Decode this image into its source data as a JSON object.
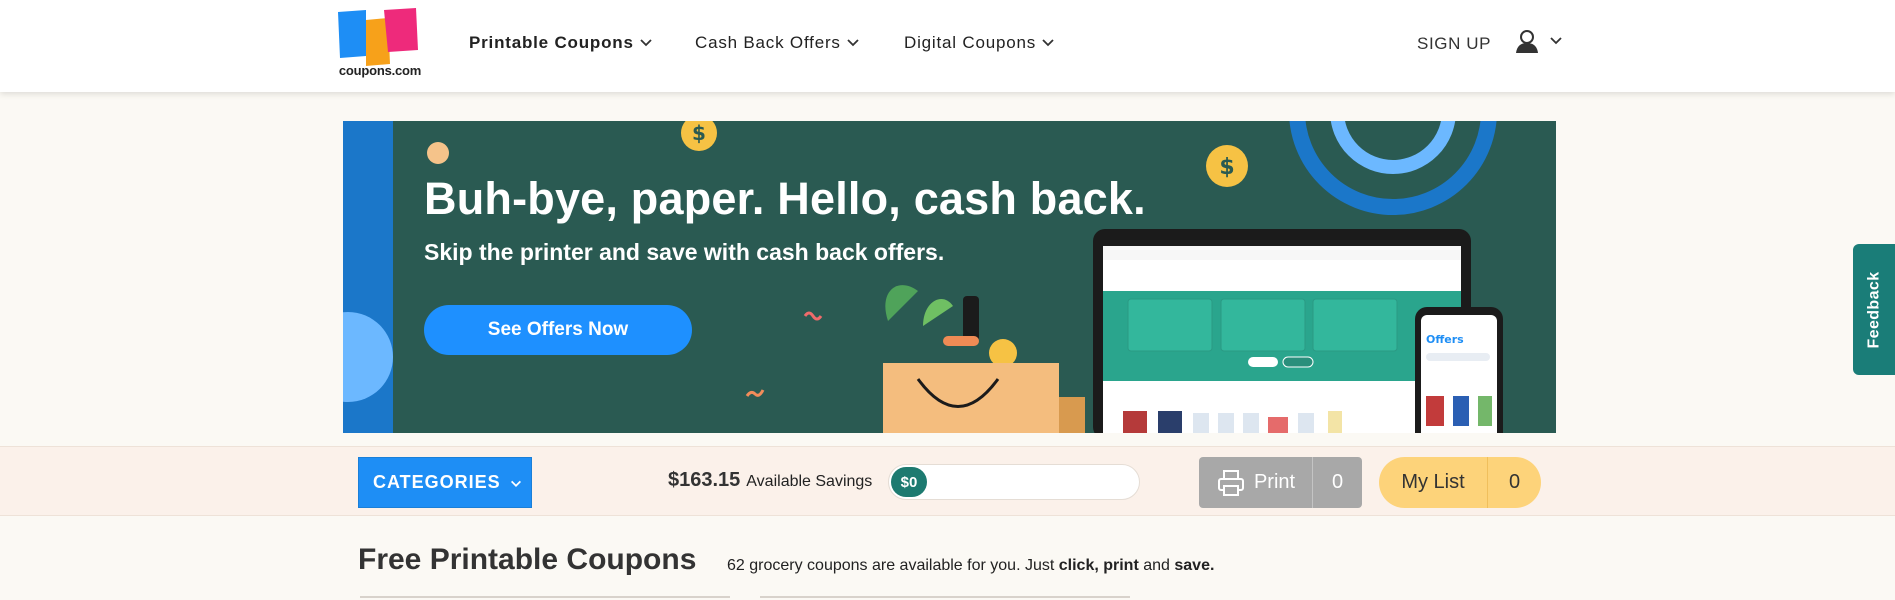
{
  "header": {
    "logo_text": "coupons.com",
    "nav": [
      {
        "label": "Printable Coupons"
      },
      {
        "label": "Cash Back Offers"
      },
      {
        "label": "Digital Coupons"
      }
    ],
    "signup_label": "SIGN UP"
  },
  "banner": {
    "title": "Buh-bye, paper. Hello, cash back.",
    "subtitle": "Skip the printer and save with cash back offers.",
    "cta_label": "See Offers Now"
  },
  "feedback_label": "Feedback",
  "toolbar": {
    "categories_label": "CATEGORIES",
    "savings_amount": "$163.15",
    "savings_label": "Available Savings",
    "savings_progress_value": "$0",
    "savings_progress_fraction": 0,
    "print_label": "Print",
    "print_count": "0",
    "mylist_label": "My List",
    "mylist_count": "0"
  },
  "page": {
    "title": "Free Printable Coupons",
    "subtitle_prefix": "62 grocery coupons are available for you. Just ",
    "subtitle_click": "click, print",
    "subtitle_and": " and ",
    "subtitle_save": "save."
  },
  "colors": {
    "brand_blue": "#1e8ef5",
    "banner_green": "#2a5a52",
    "teal": "#1d7a70",
    "mylist_yellow": "#fdd37a",
    "print_gray": "#a8a8a8"
  }
}
